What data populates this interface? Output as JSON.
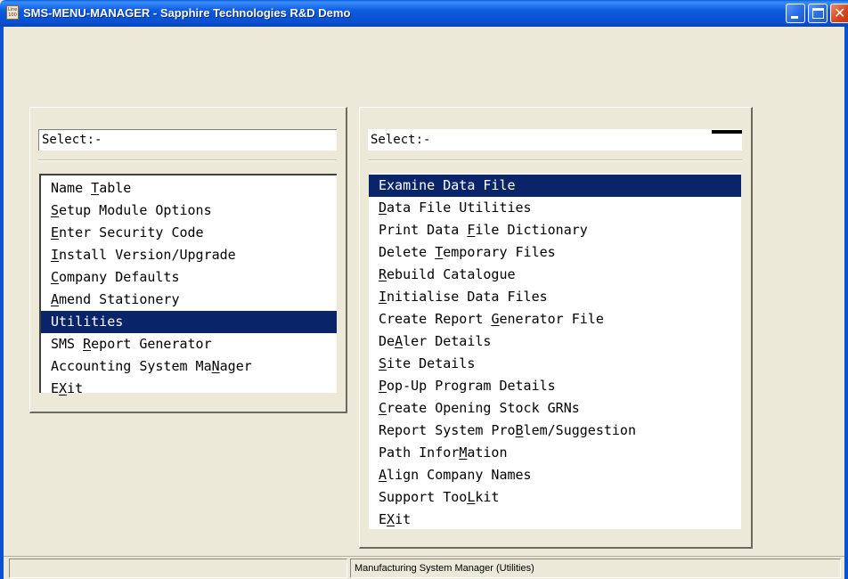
{
  "window": {
    "title": "SMS-MENU-MANAGER - Sapphire Technologies R&D Demo",
    "icon_text": "Line 100",
    "icon": "app-line100-icon"
  },
  "left_panel": {
    "select_label": "Select:-",
    "items": [
      {
        "label": "Name Table",
        "hotkey_index": 5,
        "selected": false
      },
      {
        "label": "Setup Module Options",
        "hotkey_index": 0,
        "selected": false
      },
      {
        "label": "Enter Security Code",
        "hotkey_index": 0,
        "selected": false
      },
      {
        "label": "Install Version/Upgrade",
        "hotkey_index": 0,
        "selected": false
      },
      {
        "label": "Company Defaults",
        "hotkey_index": 0,
        "selected": false
      },
      {
        "label": "Amend Stationery",
        "hotkey_index": 0,
        "selected": false
      },
      {
        "label": "Utilities",
        "hotkey_index": -1,
        "selected": true
      },
      {
        "label": "SMS Report Generator",
        "hotkey_index": 4,
        "selected": false
      },
      {
        "label": "Accounting System MaNager",
        "hotkey_index": 20,
        "selected": false
      },
      {
        "label": "EXit",
        "hotkey_index": 1,
        "selected": false
      }
    ]
  },
  "right_panel": {
    "select_label": "Select:-",
    "items": [
      {
        "label": "Examine Data File",
        "hotkey_index": -1,
        "selected": true
      },
      {
        "label": "Data File Utilities",
        "hotkey_index": 0,
        "selected": false
      },
      {
        "label": "Print Data File Dictionary",
        "hotkey_index": 11,
        "selected": false
      },
      {
        "label": "Delete Temporary Files",
        "hotkey_index": 7,
        "selected": false
      },
      {
        "label": "Rebuild Catalogue",
        "hotkey_index": 0,
        "selected": false
      },
      {
        "label": "Initialise Data Files",
        "hotkey_index": 0,
        "selected": false
      },
      {
        "label": "Create Report Generator File",
        "hotkey_index": 14,
        "selected": false
      },
      {
        "label": "DeAler Details",
        "hotkey_index": 2,
        "selected": false
      },
      {
        "label": "Site Details",
        "hotkey_index": 0,
        "selected": false
      },
      {
        "label": "Pop-Up Program Details",
        "hotkey_index": 0,
        "selected": false
      },
      {
        "label": "Create Opening Stock GRNs",
        "hotkey_index": 0,
        "selected": false
      },
      {
        "label": "Report System ProBlem/Suggestion",
        "hotkey_index": 17,
        "selected": false
      },
      {
        "label": "Path InforMation",
        "hotkey_index": 10,
        "selected": false
      },
      {
        "label": "Align Company Names",
        "hotkey_index": 0,
        "selected": false
      },
      {
        "label": "Support TooLkit",
        "hotkey_index": 11,
        "selected": false
      },
      {
        "label": "EXit",
        "hotkey_index": 1,
        "selected": false
      }
    ]
  },
  "status_bar": {
    "pane1": "",
    "pane2": "Manufacturing System Manager (Utilities)"
  },
  "colors": {
    "titlebar": "#0a50d0",
    "selection": "#0a246a",
    "dialog_bg": "#ece9d8"
  }
}
